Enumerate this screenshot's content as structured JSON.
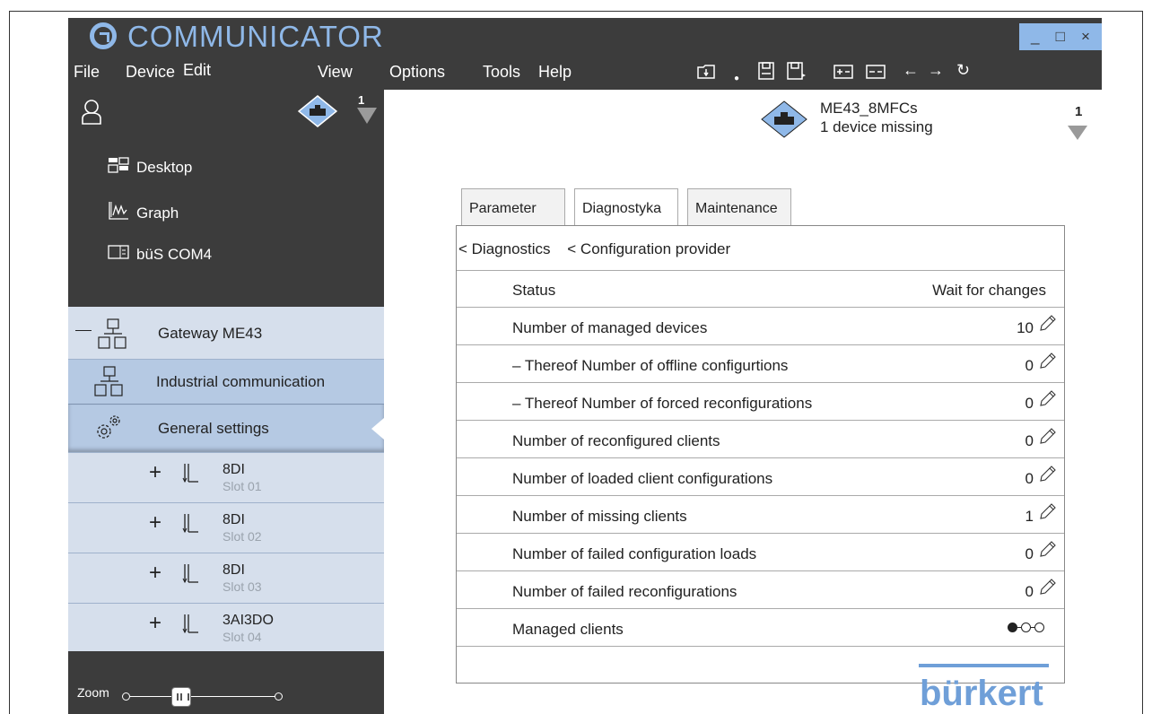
{
  "app": {
    "title": "COMMUNICATOR",
    "window_controls": [
      "_",
      "□",
      "×"
    ]
  },
  "menu": [
    "File",
    "Device",
    "Edit",
    "View",
    "Options",
    "Tools",
    "Help"
  ],
  "toolbar_icons": [
    "open-folder-icon",
    "save-icon",
    "save-as-icon",
    "import-icon",
    "export-icon",
    "back-arrow-icon",
    "forward-arrow-icon",
    "refresh-icon"
  ],
  "sidebar": {
    "badge_count": "1",
    "nav": [
      {
        "label": "Desktop",
        "icon": "desktop-icon"
      },
      {
        "label": "Graph",
        "icon": "graph-icon"
      },
      {
        "label": "büS COM4",
        "icon": "interface-icon"
      }
    ],
    "tree": {
      "gateway": "Gateway ME43",
      "industrial": "Industrial communication",
      "general": "General settings",
      "slots": [
        {
          "name": "8DI",
          "sub": "Slot 01"
        },
        {
          "name": "8DI",
          "sub": "Slot 02"
        },
        {
          "name": "8DI",
          "sub": "Slot 03"
        },
        {
          "name": "3AI3DO",
          "sub": "Slot 04"
        }
      ]
    },
    "zoom_label": "Zoom",
    "zoom_level": 0.35
  },
  "main": {
    "device_name": "ME43_8MFCs",
    "device_status": "1 device missing",
    "device_count": "1",
    "tabs": [
      "Parameter",
      "Diagnostyka",
      "Maintenance"
    ],
    "active_tab": "Diagnostyka",
    "breadcrumbs": [
      "< Diagnostics",
      "< Configuration provider"
    ],
    "rows": [
      {
        "label": "Status",
        "value": "Wait for changes",
        "editable": false
      },
      {
        "label": "Number of managed devices",
        "value": "10",
        "editable": true
      },
      {
        "label": "– Thereof Number of offline configurtions",
        "value": "0",
        "editable": true
      },
      {
        "label": "– Thereof Number of forced reconfigurations",
        "value": "0",
        "editable": true
      },
      {
        "label": "Number of reconfigured clients",
        "value": "0",
        "editable": true
      },
      {
        "label": "Number of loaded client configurations",
        "value": "0",
        "editable": true
      },
      {
        "label": "Number of missing clients",
        "value": "1",
        "editable": true
      },
      {
        "label": "Number of failed configuration loads",
        "value": "0",
        "editable": true
      },
      {
        "label": "Number of failed reconfigurations",
        "value": "0",
        "editable": true
      },
      {
        "label": "Managed clients",
        "value": "",
        "editable": false
      }
    ],
    "managed_clients_state": [
      true,
      false,
      false
    ]
  },
  "brand": "bürkert",
  "colors": {
    "chrome": "#3c3c3c",
    "accent": "#8fb8e8",
    "tree_light": "#d6dfec",
    "tree_selected": "#b5c9e3",
    "brand_blue": "#6f9fd8"
  }
}
